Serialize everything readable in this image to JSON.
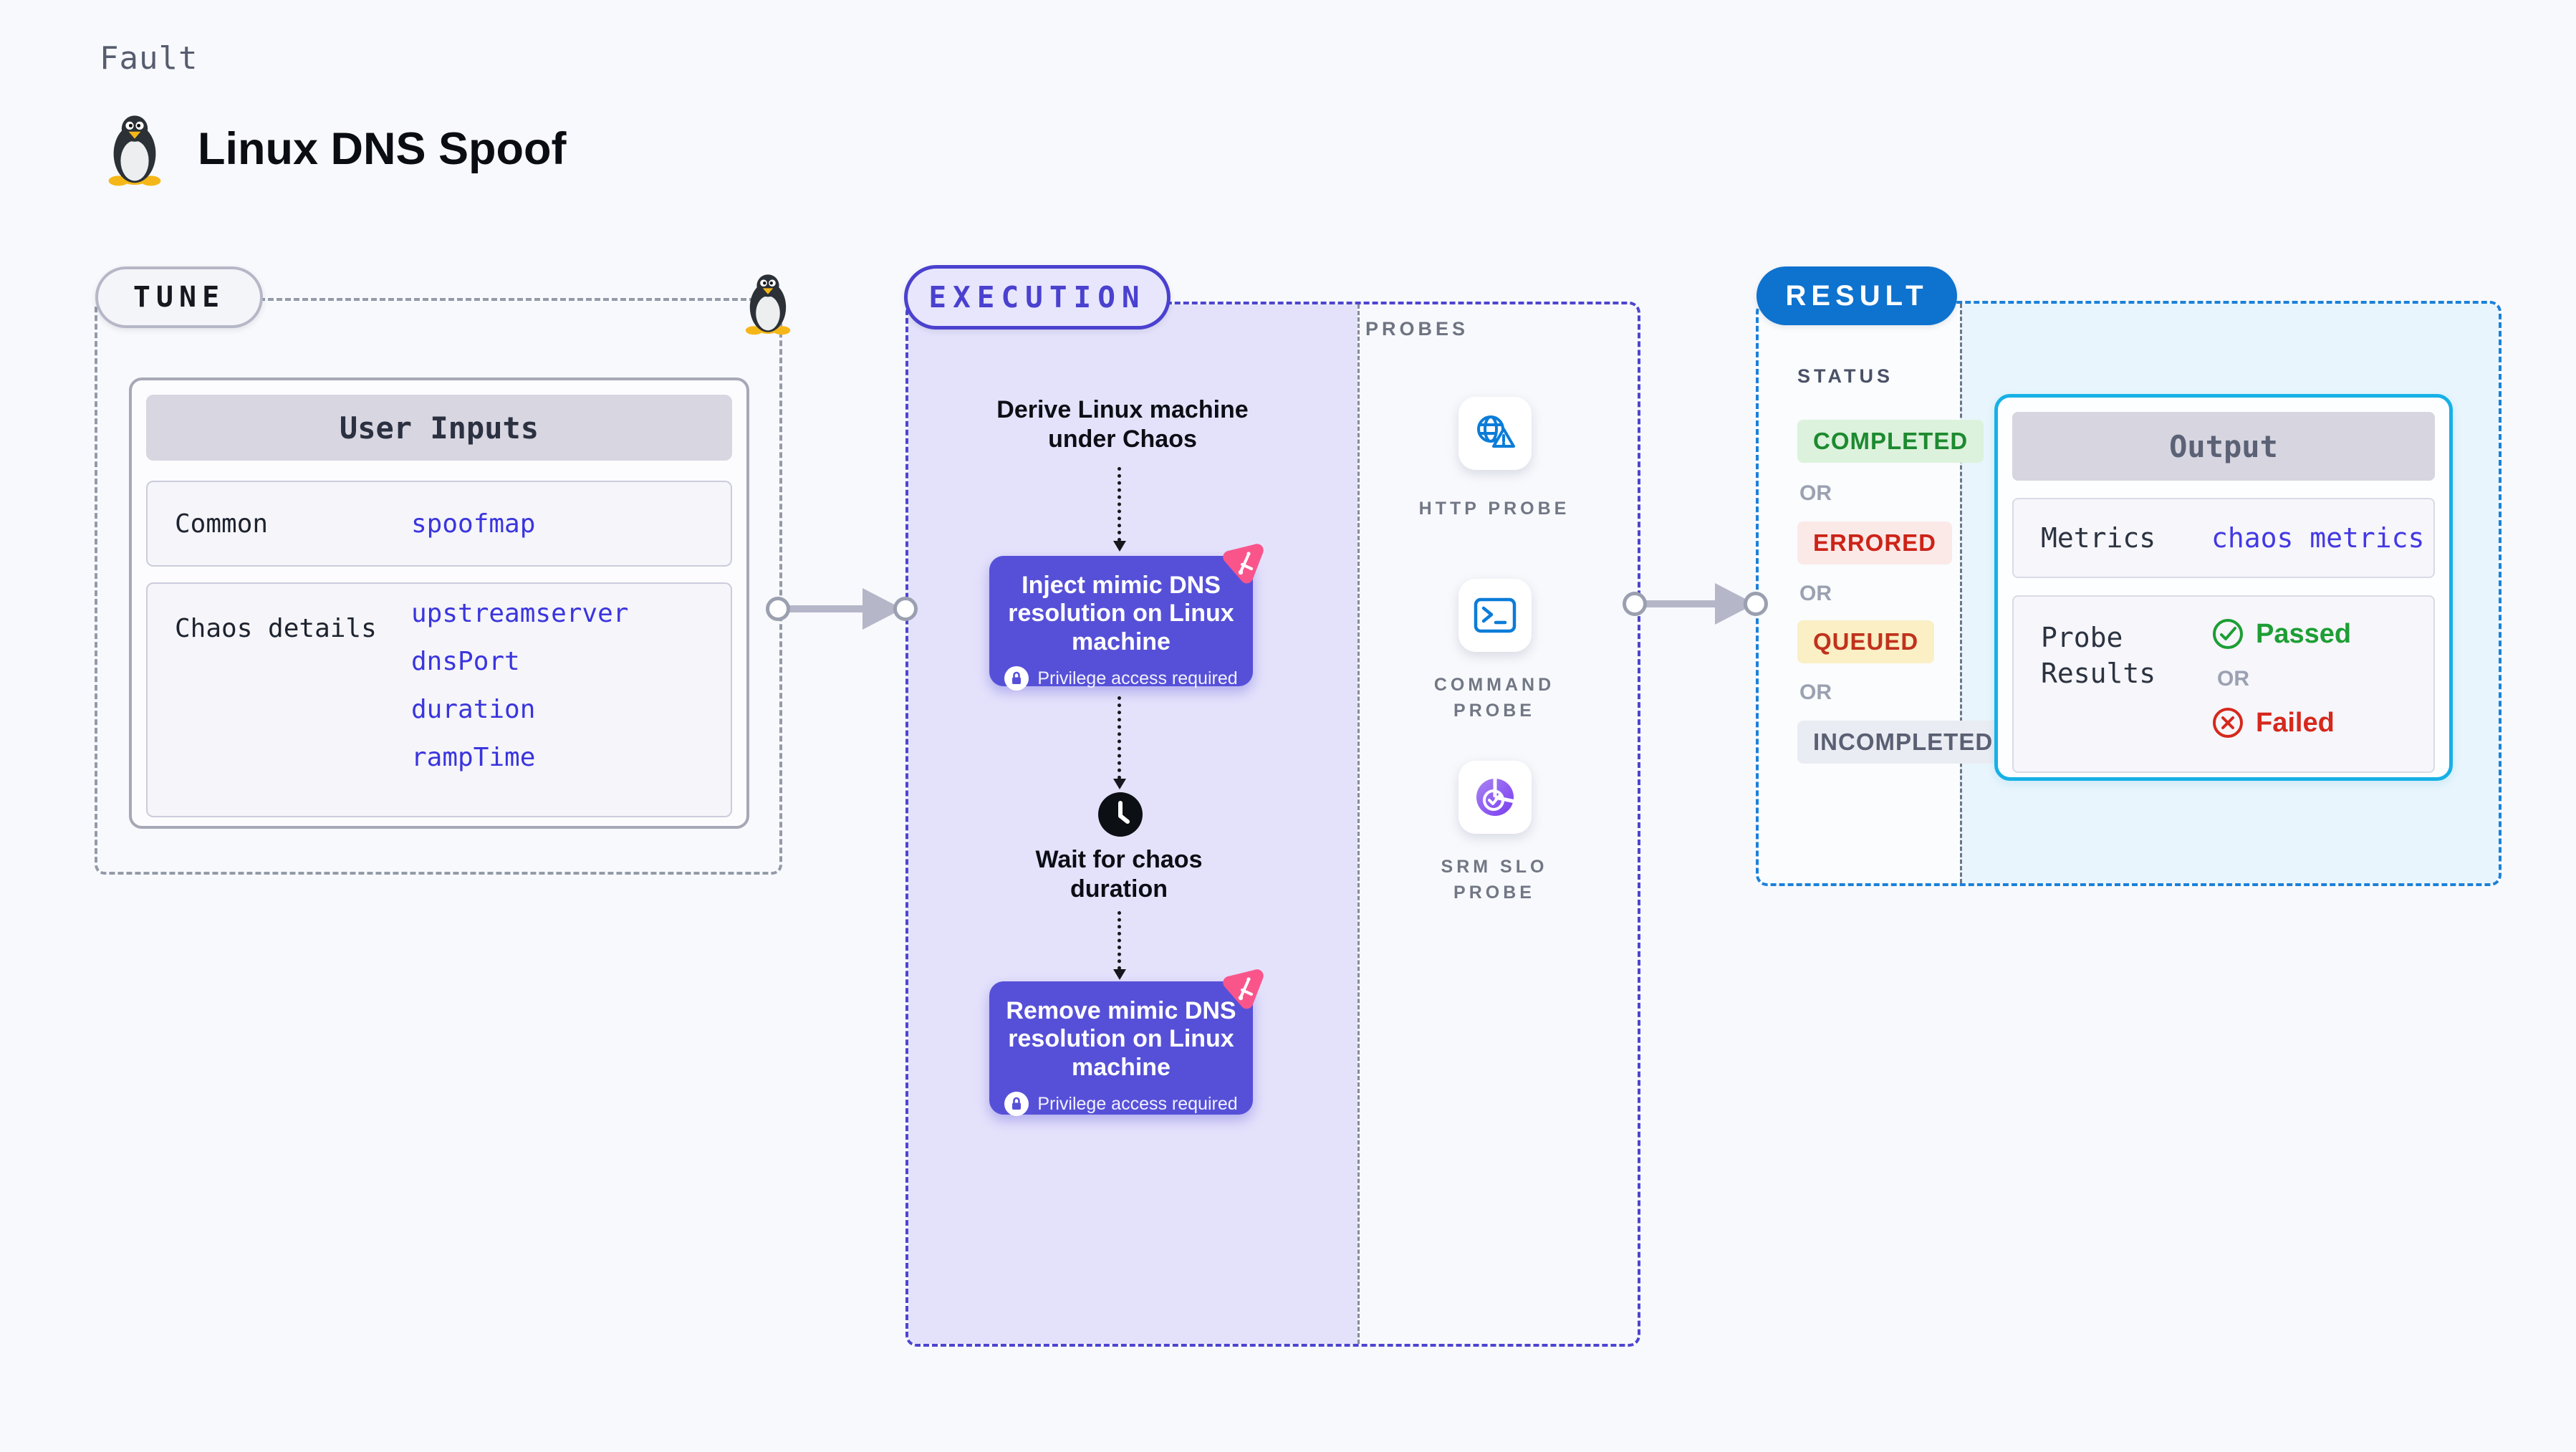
{
  "header": {
    "kicker": "Fault",
    "title": "Linux DNS Spoof",
    "icon": "tux-penguin-icon"
  },
  "tune": {
    "badge_label": "TUNE",
    "user_inputs": {
      "title": "User Inputs",
      "rows": [
        {
          "label": "Common",
          "values": [
            "spoofmap"
          ]
        },
        {
          "label": "Chaos details",
          "values": [
            "upstreamserver",
            "dnsPort",
            "duration",
            "rampTime"
          ]
        }
      ]
    }
  },
  "execution": {
    "badge_label": "EXECUTION",
    "derive_step": "Derive Linux machine under Chaos",
    "inject_step": {
      "title": "Inject mimic DNS resolution on Linux machine",
      "note": "Privilege access required",
      "icon": "chaos-spark-icon"
    },
    "wait_step": "Wait for chaos duration",
    "wait_icon": "clock-icon",
    "remove_step": {
      "title": "Remove mimic DNS resolution on Linux machine",
      "note": "Privilege access required",
      "icon": "chaos-spark-icon"
    },
    "probes": {
      "title": "PROBES",
      "items": [
        {
          "label": "HTTP PROBE",
          "icon": "globe-warning-icon"
        },
        {
          "label": "COMMAND PROBE",
          "icon": "terminal-icon"
        },
        {
          "label": "SRM SLO PROBE",
          "icon": "slo-donut-check-icon"
        }
      ]
    }
  },
  "result": {
    "badge_label": "RESULT",
    "status": {
      "title": "STATUS",
      "or_label": "OR",
      "items": [
        {
          "label": "COMPLETED",
          "fg": "#1d8a30",
          "bg": "#dcf2dc"
        },
        {
          "label": "ERRORED",
          "fg": "#cd2317",
          "bg": "#fbe9e8"
        },
        {
          "label": "QUEUED",
          "fg": "#c0321c",
          "bg": "#faefc5"
        },
        {
          "label": "INCOMPLETED",
          "fg": "#5a6073",
          "bg": "#eaecf3"
        }
      ]
    },
    "output": {
      "title": "Output",
      "metrics_label": "Metrics",
      "metrics_value": "chaos metrics",
      "probe_results_label": "Probe Results",
      "passed_label": "Passed",
      "or_label": "OR",
      "failed_label": "Failed",
      "passed_icon": "check-circle-icon",
      "failed_icon": "x-circle-icon"
    }
  },
  "colors": {
    "page_bg": "#f8f9fc",
    "exec_fill": "#e4e2fb",
    "exec_border": "#4c45d0",
    "chaos_step_bg": "#5650d8",
    "chaos_spark_pink": "#f9558b",
    "result_border": "#1b81d9",
    "result_pill_bg": "#0e72cf",
    "result_fill": "#e8f5fc",
    "output_border": "#16b1e6",
    "link_value": "#3a35dd",
    "probe_icon_blue": "#0b7cd8",
    "passed_green": "#1d9e34",
    "failed_red": "#d6281c",
    "arrow_gray": "#b5b6c8",
    "tune_border": "#949aa8"
  }
}
